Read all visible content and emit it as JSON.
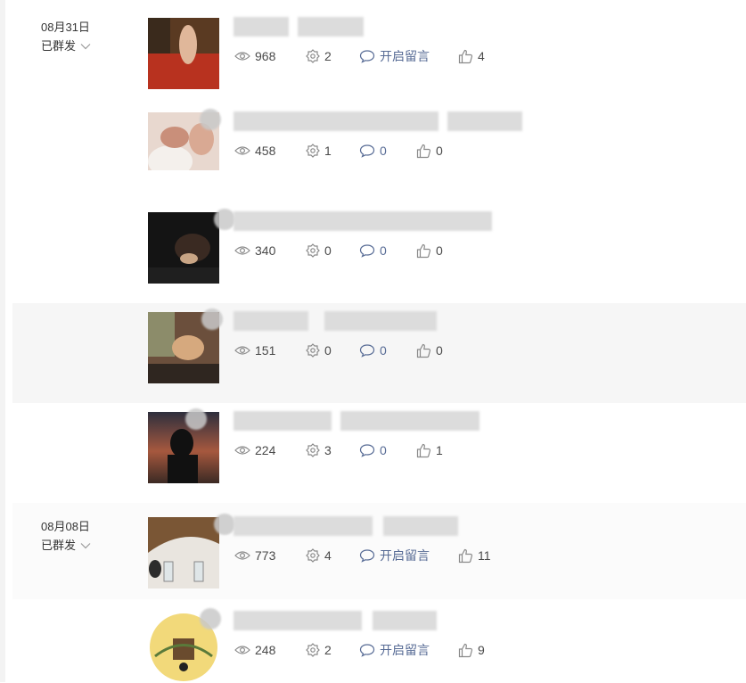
{
  "accent_color": "#576b95",
  "icons": [
    "eye-icon",
    "share-icon",
    "comment-icon",
    "thumb-up-icon",
    "chevron-down-icon"
  ],
  "groups": [
    {
      "date": "08月31日",
      "status": "已群发",
      "articles": [
        {
          "views": "968",
          "shares": "2",
          "comments": "开启留言",
          "likes": "4"
        },
        {
          "views": "458",
          "shares": "1",
          "comments": "0",
          "likes": "0"
        },
        {
          "views": "340",
          "shares": "0",
          "comments": "0",
          "likes": "0"
        },
        {
          "views": "151",
          "shares": "0",
          "comments": "0",
          "likes": "0"
        },
        {
          "views": "224",
          "shares": "3",
          "comments": "0",
          "likes": "1"
        }
      ]
    },
    {
      "date": "08月08日",
      "status": "已群发",
      "articles": [
        {
          "views": "773",
          "shares": "4",
          "comments": "开启留言",
          "likes": "11"
        },
        {
          "views": "248",
          "shares": "2",
          "comments": "开启留言",
          "likes": "9"
        }
      ]
    }
  ]
}
